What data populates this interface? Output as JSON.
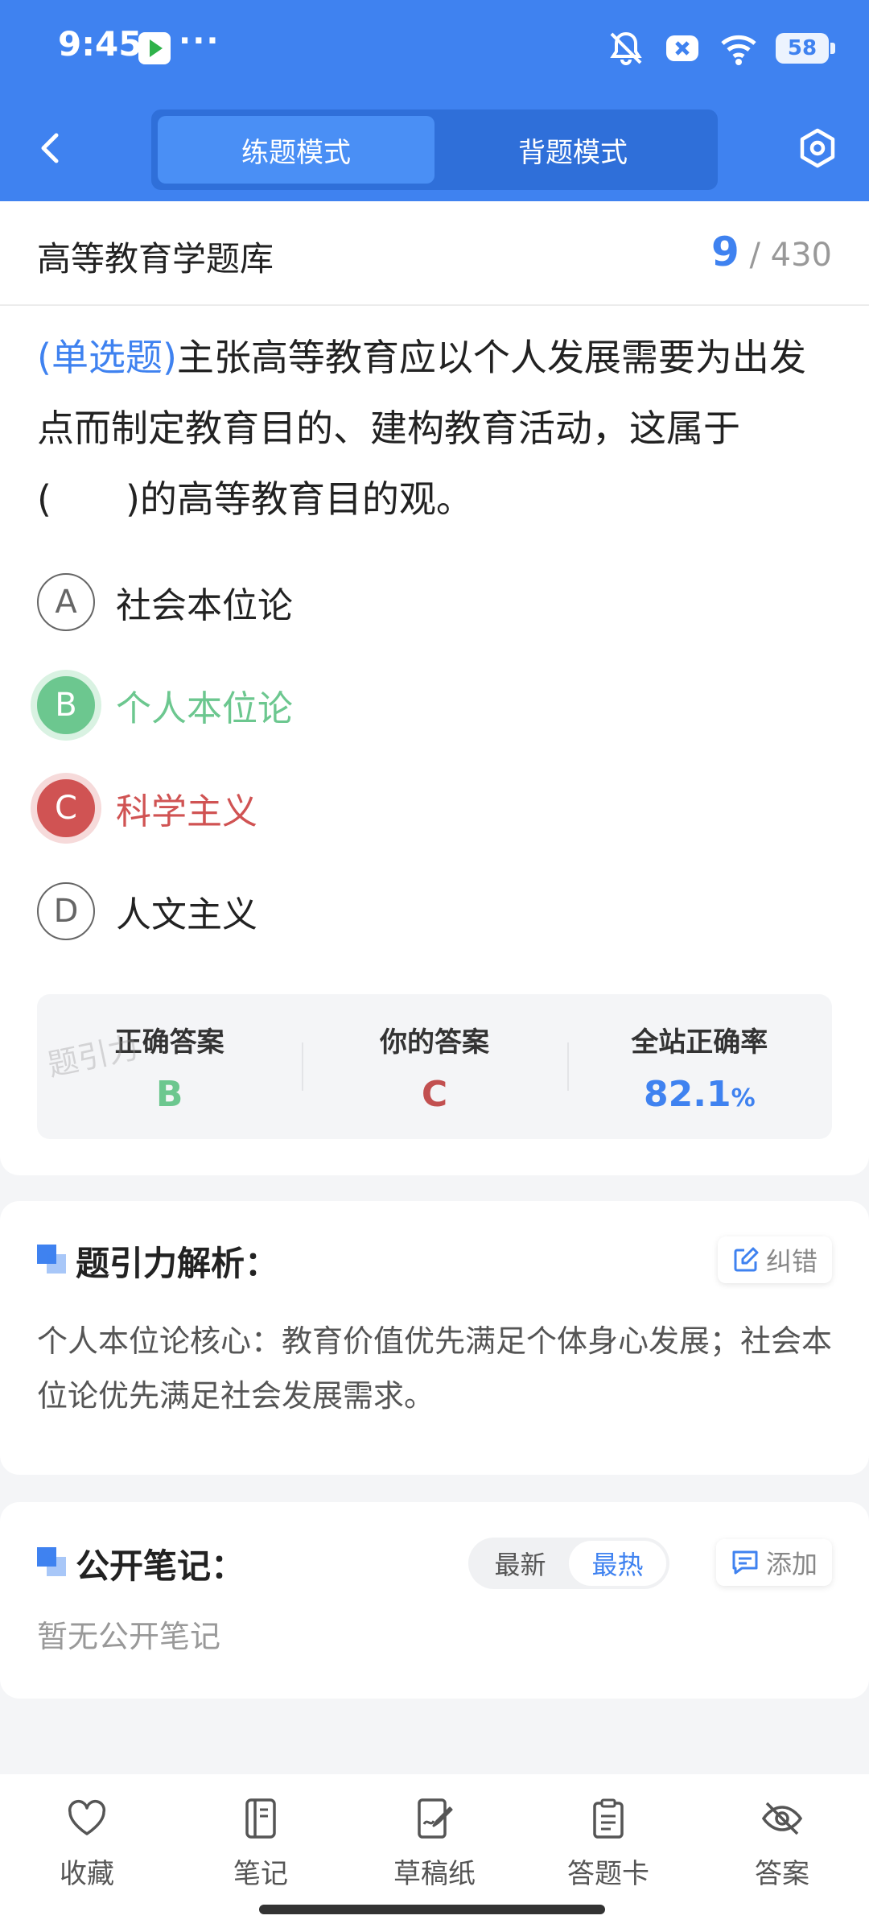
{
  "status_bar": {
    "time": "9:45",
    "more": "···",
    "battery": "58"
  },
  "header": {
    "tabs": [
      {
        "label": "练题模式",
        "active": true
      },
      {
        "label": "背题模式",
        "active": false
      }
    ]
  },
  "question_bank": {
    "title": "高等教育学题库",
    "current": "9",
    "total": "/ 430"
  },
  "question": {
    "type": "(单选题)",
    "text": "主张高等教育应以个人发展需要为出发点而制定教育目的、建构教育活动，这属于(　　)的高等教育目的观。",
    "options": [
      {
        "letter": "A",
        "text": "社会本位论",
        "state": "normal"
      },
      {
        "letter": "B",
        "text": "个人本位论",
        "state": "correct"
      },
      {
        "letter": "C",
        "text": "科学主义",
        "state": "wrong"
      },
      {
        "letter": "D",
        "text": "人文主义",
        "state": "normal"
      }
    ]
  },
  "stats": {
    "watermark": "题引力",
    "correct_label": "正确答案",
    "correct_value": "B",
    "your_label": "你的答案",
    "your_value": "C",
    "rate_label": "全站正确率",
    "rate_value": "82.1",
    "rate_unit": "%"
  },
  "analysis": {
    "title": "题引力解析：",
    "correction_label": "纠错",
    "text": "个人本位论核心：教育价值优先满足个体身心发展；社会本位论优先满足社会发展需求。"
  },
  "notes": {
    "title": "公开笔记：",
    "sort_options": [
      {
        "label": "最新",
        "active": false
      },
      {
        "label": "最热",
        "active": true
      }
    ],
    "add_label": "添加",
    "empty_text": "暂无公开笔记"
  },
  "bottom_nav": [
    {
      "label": "收藏",
      "icon": "heart-icon"
    },
    {
      "label": "笔记",
      "icon": "notebook-icon"
    },
    {
      "label": "草稿纸",
      "icon": "draft-icon"
    },
    {
      "label": "答题卡",
      "icon": "clipboard-icon"
    },
    {
      "label": "答案",
      "icon": "eye-off-icon"
    }
  ],
  "colors": {
    "primary": "#3f82f0",
    "correct": "#6cc78f",
    "wrong": "#d05353"
  }
}
